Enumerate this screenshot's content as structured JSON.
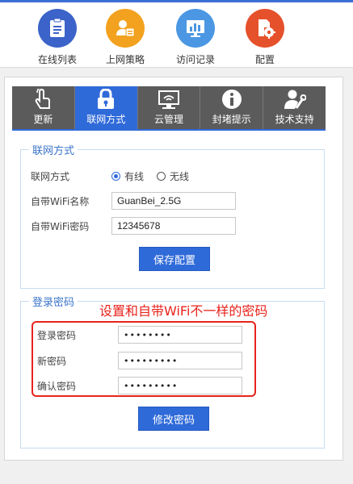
{
  "nav": [
    {
      "label": "在线列表",
      "icon": "list-icon",
      "color": "#3b63c9"
    },
    {
      "label": "上网策略",
      "icon": "user-policy-icon",
      "color": "#f2a21f"
    },
    {
      "label": "访问记录",
      "icon": "bar-chart-icon",
      "color": "#4b97e3"
    },
    {
      "label": "配置",
      "icon": "config-gear-icon",
      "color": "#e5512b"
    }
  ],
  "tabs": [
    {
      "label": "更新",
      "icon": "touch-icon",
      "active": false
    },
    {
      "label": "联网方式",
      "icon": "lock-icon",
      "active": true
    },
    {
      "label": "云管理",
      "icon": "monitor-icon",
      "active": false
    },
    {
      "label": "封堵提示",
      "icon": "info-icon",
      "active": false
    },
    {
      "label": "技术支持",
      "icon": "support-icon",
      "active": false
    }
  ],
  "network": {
    "legend": "联网方式",
    "mode_label": "联网方式",
    "mode_options": [
      "有线",
      "无线"
    ],
    "mode_selected": "有线",
    "wifi_name_label": "自带WiFi名称",
    "wifi_name_value": "GuanBei_2.5G",
    "wifi_password_label": "自带WiFi密码",
    "wifi_password_value": "12345678",
    "save_button": "保存配置"
  },
  "login": {
    "legend": "登录密码",
    "annotation": "设置和自带WiFi不一样的密码",
    "current_label": "登录密码",
    "current_value": "••••••••",
    "new_label": "新密码",
    "new_value": "•••••••••",
    "confirm_label": "确认密码",
    "confirm_value": "•••••••••",
    "modify_button": "修改密码"
  },
  "colors": {
    "accent": "#2f6ad9",
    "annotation": "#e8231c",
    "tab_bg": "#5b5b5b"
  }
}
